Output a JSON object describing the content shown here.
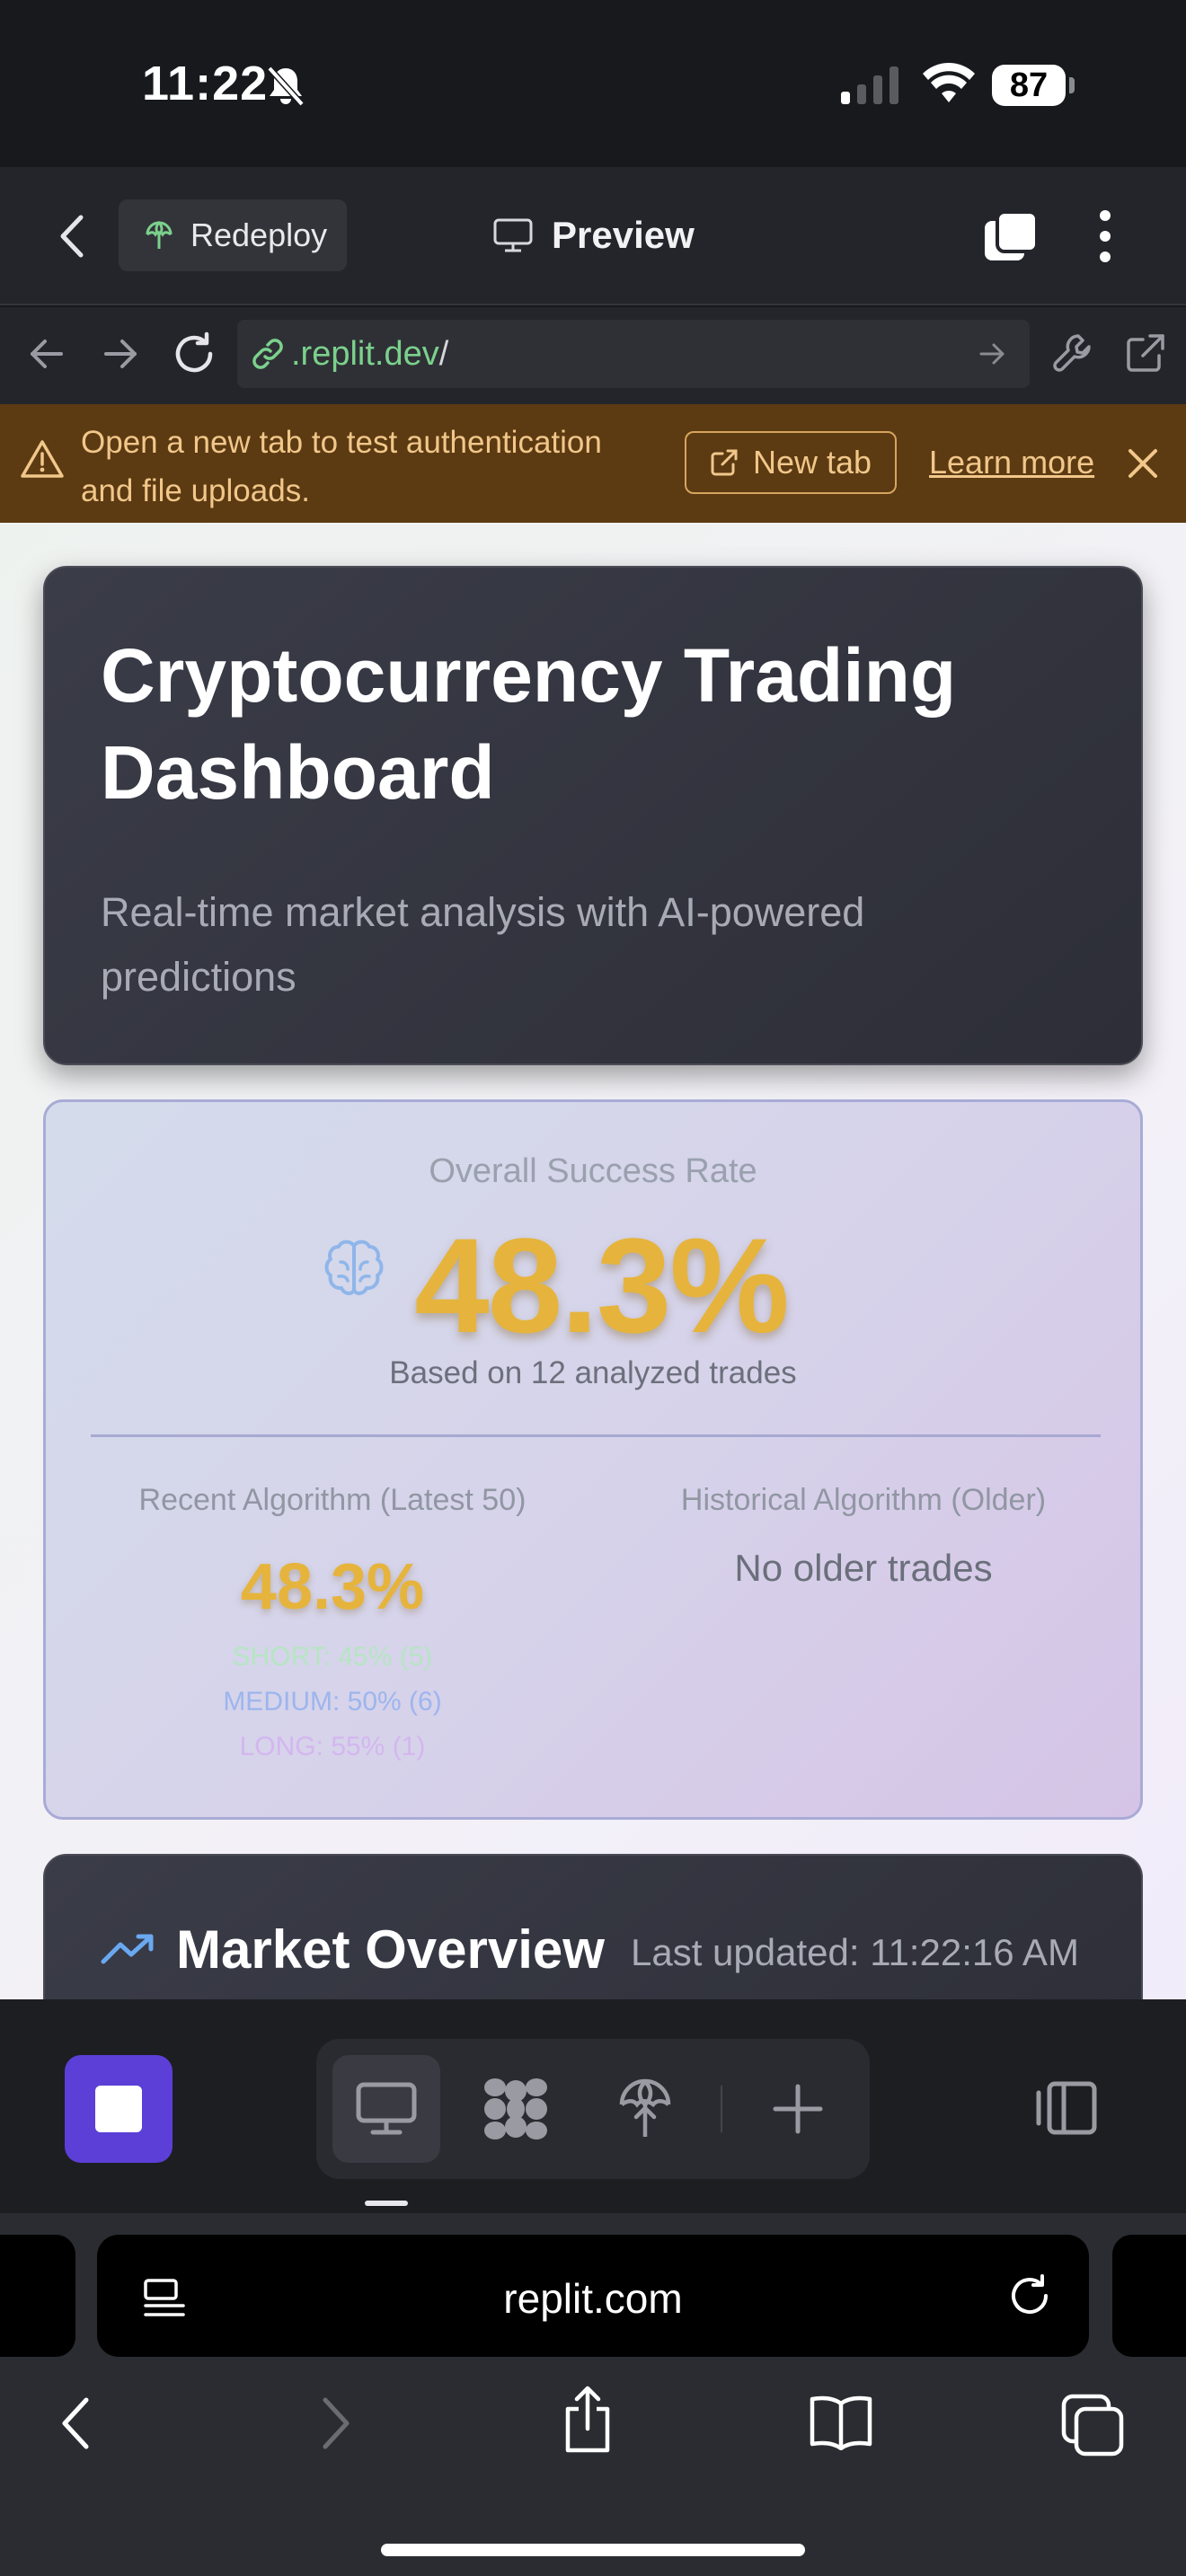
{
  "status_bar": {
    "time": "11:22",
    "battery": "87"
  },
  "toolbar": {
    "redeploy_label": "Redeploy",
    "preview_label": "Preview"
  },
  "url_bar": {
    "domain": ".replit.dev",
    "path": "/"
  },
  "banner": {
    "message": "Open a new tab to test authentication and file uploads.",
    "new_tab_label": "New tab",
    "learn_more_label": "Learn more"
  },
  "hero": {
    "title": "Cryptocurrency Trading Dashboard",
    "subtitle": "Real-time market analysis with AI-powered predictions"
  },
  "success_rate": {
    "label": "Overall Success Rate",
    "value": "48.3%",
    "subtext": "Based on 12 analyzed trades",
    "recent": {
      "title": "Recent Algorithm (Latest 50)",
      "value": "48.3%",
      "short": "SHORT: 45% (5)",
      "medium": "MEDIUM: 50% (6)",
      "long": "LONG: 55% (1)"
    },
    "historical": {
      "title": "Historical Algorithm (Older)",
      "value": "No older trades"
    }
  },
  "market": {
    "title": "Market Overview",
    "last_updated": "Last updated: 11:22:16 AM"
  },
  "safari": {
    "host": "replit.com"
  },
  "colors": {
    "accent_gold": "#e6b43c",
    "stop_button": "#5b3fd6",
    "banner_bg": "#5c3a12",
    "url_green": "#7bd18c"
  }
}
